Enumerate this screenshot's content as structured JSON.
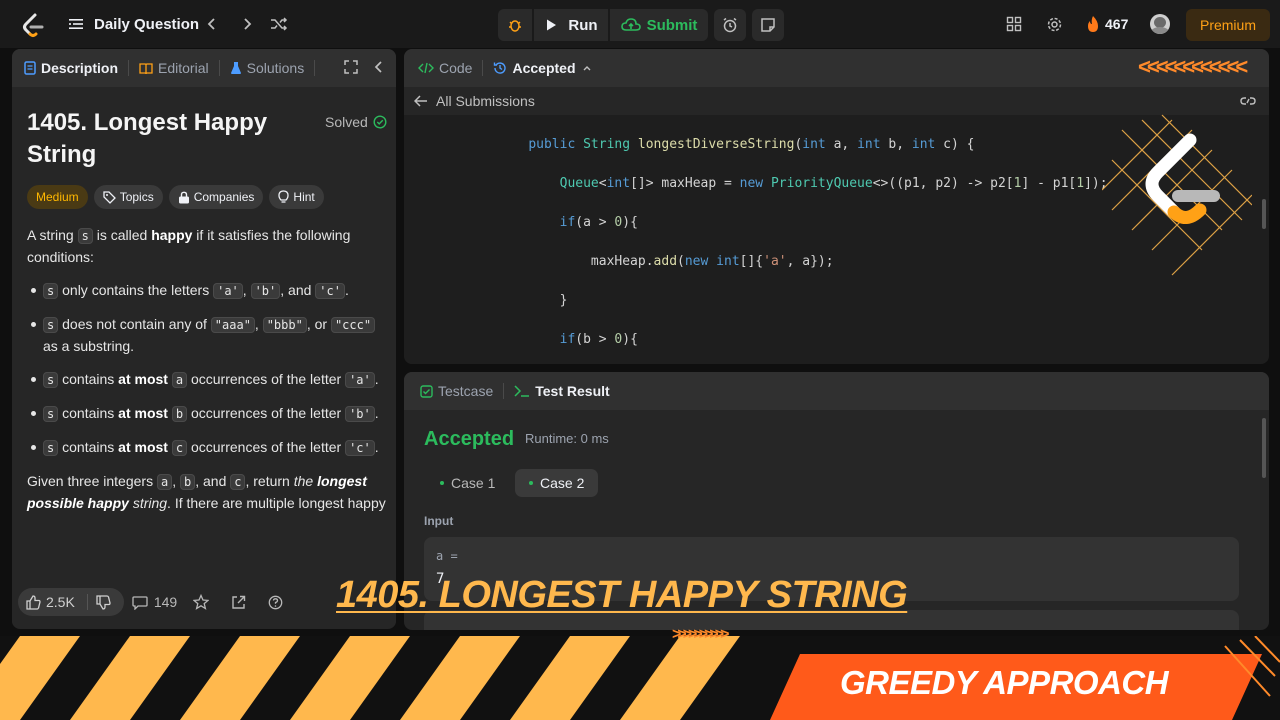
{
  "topbar": {
    "title": "Daily Question",
    "run": "Run",
    "submit": "Submit",
    "streak": "467",
    "premium": "Premium"
  },
  "left": {
    "tabs": [
      "Description",
      "Editorial",
      "Solutions"
    ],
    "problem_title": "1405. Longest Happy String",
    "solved": "Solved",
    "chips": [
      "Medium",
      "Topics",
      "Companies",
      "Hint"
    ],
    "likes": "2.5K",
    "comments": "149"
  },
  "code_panel": {
    "tabs": [
      "Code",
      "Accepted"
    ],
    "back": "All Submissions"
  },
  "result": {
    "tabs": [
      "Testcase",
      "Test Result"
    ],
    "status": "Accepted",
    "runtime": "Runtime: 0 ms",
    "cases": [
      "Case 1",
      "Case 2"
    ],
    "input_label": "Input",
    "input_key": "a =",
    "input_value": "7"
  },
  "overlay": {
    "headline": "1405. LONGEST HAPPY STRING",
    "approach": "GREEDY APPROACH"
  },
  "colors": {
    "accent": "#ffa116",
    "accepted": "#2cbb5d",
    "banner_orange": "#ff5a1a"
  }
}
